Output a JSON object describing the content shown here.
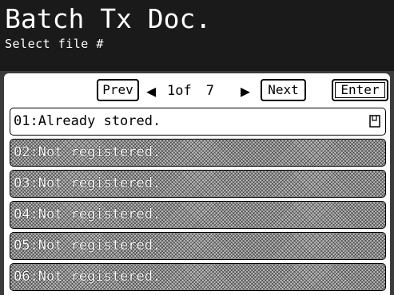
{
  "header": {
    "title": "Batch Tx Doc.",
    "subtitle": "Select file #"
  },
  "nav": {
    "prev_label": "Prev",
    "next_label": "Next",
    "enter_label": "Enter",
    "current_page": "1of",
    "total_pages": "7",
    "left_arrow": "◀",
    "right_arrow": "▶"
  },
  "files": [
    {
      "label": "01:Already stored.",
      "state": "stored",
      "icon": "document-icon"
    },
    {
      "label": "02:Not registered.",
      "state": "empty"
    },
    {
      "label": "03:Not registered.",
      "state": "empty"
    },
    {
      "label": "04:Not registered.",
      "state": "empty"
    },
    {
      "label": "05:Not registered.",
      "state": "empty"
    },
    {
      "label": "06:Not registered.",
      "state": "empty"
    }
  ],
  "colors": {
    "header_bg": "#1a1a1a",
    "panel_bg": "#3b3b3b",
    "disabled_row": "#bdbdbd"
  }
}
